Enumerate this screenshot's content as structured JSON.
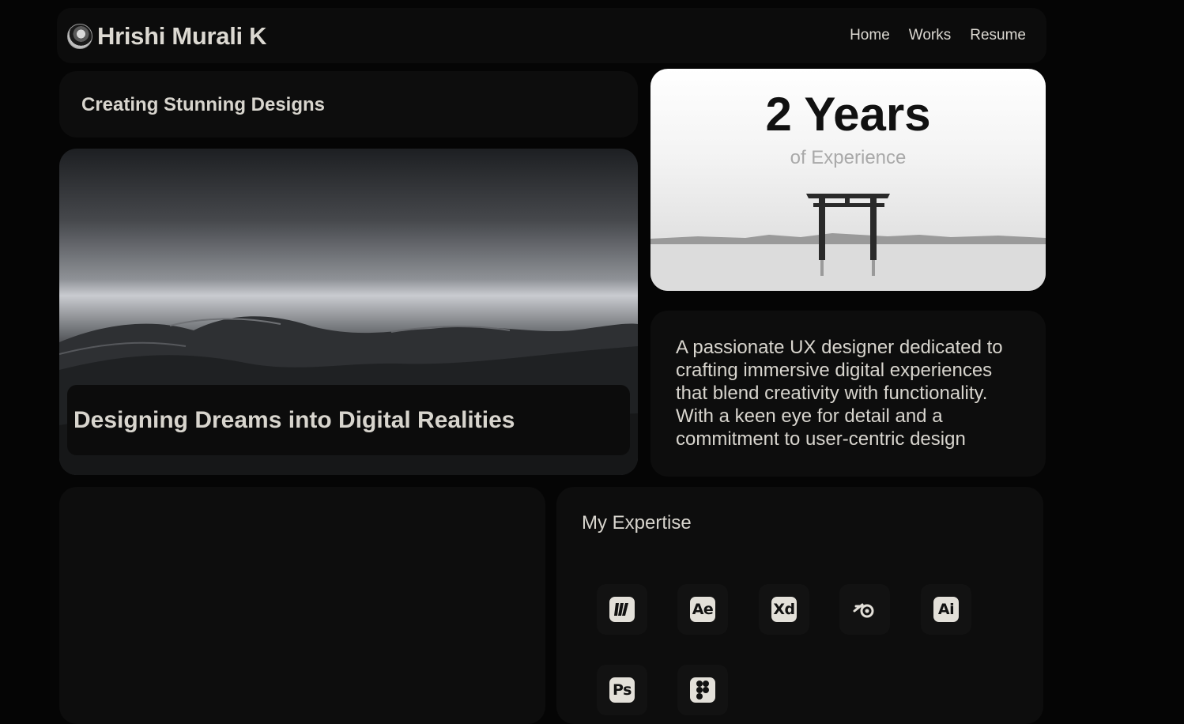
{
  "header": {
    "avatar": "avatar-photo",
    "name": "Hrishi Murali K",
    "nav": [
      {
        "label": "Home"
      },
      {
        "label": "Works"
      },
      {
        "label": "Resume"
      }
    ]
  },
  "tagline": "Creating Stunning Designs",
  "hero": {
    "title": "Designing Dreams into Digital Realities",
    "image": "grayscale-dunes-landscape"
  },
  "experience": {
    "value": "2 Years",
    "label": "of Experience",
    "image": "torii-gate-on-lake"
  },
  "about": {
    "text": "A passionate UX designer dedicated to crafting immersive digital experiences that blend creativity with functionality. With a keen eye for detail and a commitment to user-centric design"
  },
  "expertise": {
    "title": "My Expertise",
    "tools": [
      {
        "icon": "miro-icon",
        "abbr": ""
      },
      {
        "icon": "after-effects-icon",
        "abbr": "Ae"
      },
      {
        "icon": "adobe-xd-icon",
        "abbr": "Xd"
      },
      {
        "icon": "blender-icon",
        "abbr": ""
      },
      {
        "icon": "illustrator-icon",
        "abbr": "Ai"
      },
      {
        "icon": "photoshop-icon",
        "abbr": "Ps"
      },
      {
        "icon": "figma-icon",
        "abbr": ""
      }
    ]
  },
  "colors": {
    "background": "#050505",
    "card": "#0d0d0d",
    "text": "#d8d5ce",
    "accent_card": "#ffffff"
  }
}
